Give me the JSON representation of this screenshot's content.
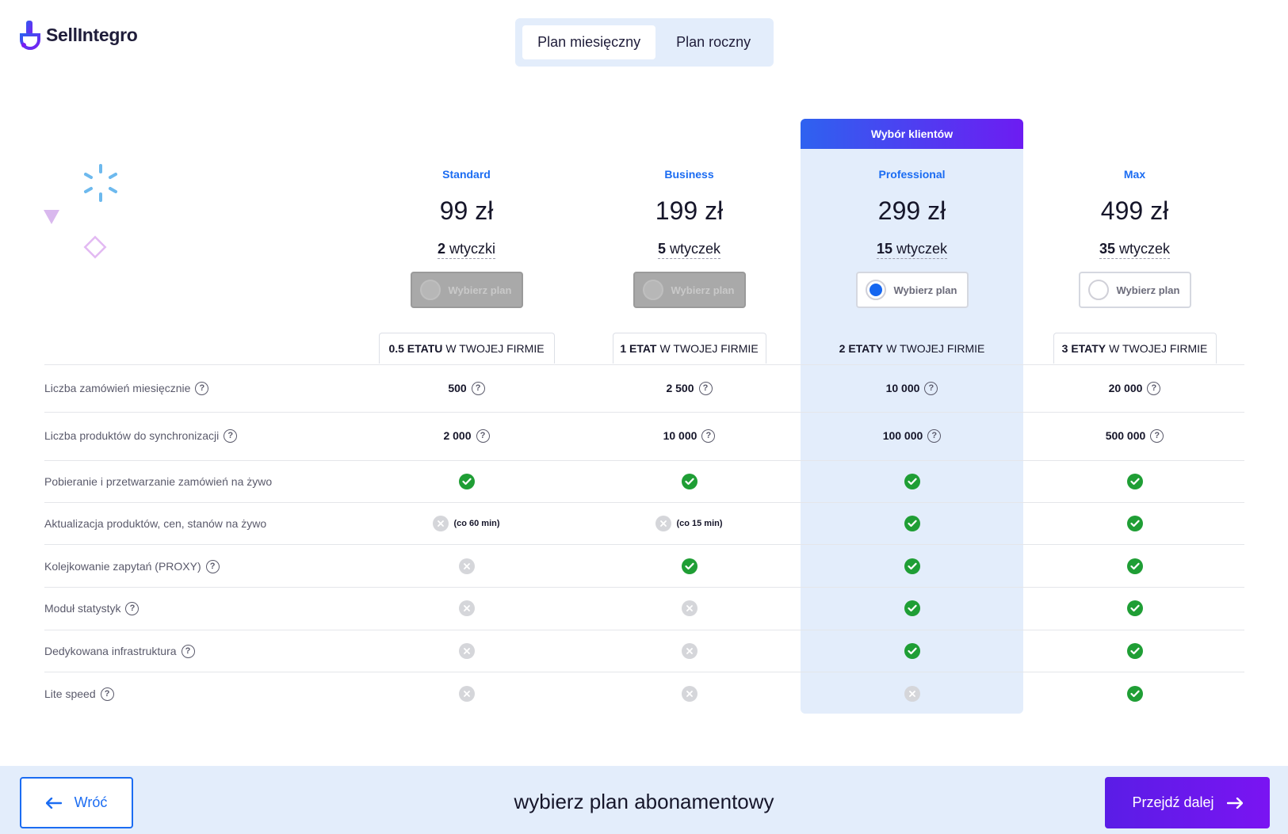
{
  "brand": {
    "name": "SellIntegro"
  },
  "billing_toggle": {
    "monthly": "Plan miesięczny",
    "yearly": "Plan roczny"
  },
  "badge": "Wybór klientów",
  "select_label": "Wybierz plan",
  "plans": [
    {
      "name": "Standard",
      "price": "99 zł",
      "plugins_count": "2",
      "plugins_word": "wtyczki",
      "etat_bold": "0.5 ETATU",
      "etat_rest": "W TWOJEJ FIRMIE"
    },
    {
      "name": "Business",
      "price": "199 zł",
      "plugins_count": "5",
      "plugins_word": "wtyczek",
      "etat_bold": "1 ETAT",
      "etat_rest": "W TWOJEJ FIRMIE"
    },
    {
      "name": "Professional",
      "price": "299 zł",
      "plugins_count": "15",
      "plugins_word": "wtyczek",
      "etat_bold": "2 ETATY",
      "etat_rest": "W TWOJEJ FIRMIE"
    },
    {
      "name": "Max",
      "price": "499 zł",
      "plugins_count": "35",
      "plugins_word": "wtyczek",
      "etat_bold": "3 ETATY",
      "etat_rest": "W TWOJEJ FIRMIE"
    }
  ],
  "features": [
    {
      "label": "Liczba zamówień miesięcznie",
      "help": true,
      "cells": [
        "500",
        "2 500",
        "10 000",
        "20 000"
      ]
    },
    {
      "label": "Liczba produktów do synchronizacji",
      "help": true,
      "cells": [
        "2 000",
        "10 000",
        "100 000",
        "500 000"
      ]
    },
    {
      "label": "Pobieranie i przetwarzanie zamówień na żywo",
      "help": false,
      "cells": [
        "check",
        "check",
        "check",
        "check"
      ]
    },
    {
      "label": "Aktualizacja produktów, cen, stanów na żywo",
      "help": false,
      "cells": [
        "cross",
        "cross",
        "check",
        "check"
      ],
      "notes": [
        "(co 60 min)",
        "(co 15 min)",
        "",
        ""
      ]
    },
    {
      "label": "Kolejkowanie zapytań (PROXY)",
      "help": true,
      "cells": [
        "cross",
        "check",
        "check",
        "check"
      ]
    },
    {
      "label": "Moduł statystyk",
      "help": true,
      "cells": [
        "cross",
        "cross",
        "check",
        "check"
      ]
    },
    {
      "label": "Dedykowana infrastruktura",
      "help": true,
      "cells": [
        "cross",
        "cross",
        "check",
        "check"
      ]
    },
    {
      "label": "Lite speed",
      "help": true,
      "cells": [
        "cross",
        "cross",
        "cross",
        "check"
      ]
    }
  ],
  "footer": {
    "back": "Wróć",
    "title": "wybierz plan abonamentowy",
    "next": "Przejdź dalej"
  },
  "colors": {
    "accent": "#1b6cf2",
    "purple": "#6d1cf2",
    "check": "#1f9e35",
    "highlight": "#e3edfb"
  }
}
